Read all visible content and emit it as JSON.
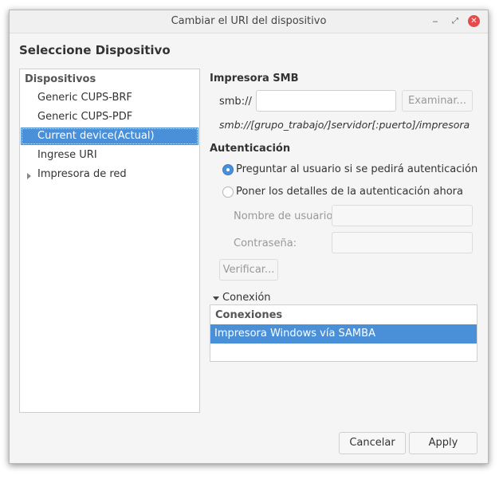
{
  "window": {
    "title": "Cambiar el URI del dispositivo",
    "controls": {
      "minimize": "‒",
      "maximize": "⤢",
      "close": "✕"
    }
  },
  "heading": "Seleccione Dispositivo",
  "devices": {
    "header": "Dispositivos",
    "items": [
      {
        "label": "Generic CUPS-BRF"
      },
      {
        "label": "Generic CUPS-PDF"
      },
      {
        "label": "Current device(Actual)",
        "selected": true
      },
      {
        "label": "Ingrese URI"
      },
      {
        "label": "Impresora de red",
        "expandable": true
      }
    ]
  },
  "smb": {
    "section_title": "Impresora SMB",
    "prefix": "smb://",
    "uri_value": "",
    "browse_label": "Examinar...",
    "hint": "smb://[grupo_trabajo/]servidor[:puerto]/impresora"
  },
  "auth": {
    "section_title": "Autenticación",
    "option_prompt": "Preguntar al usuario si se pedirá autenticación",
    "option_now": "Poner los detalles de la autenticación ahora",
    "selected_option": "prompt",
    "username_label": "Nombre de usuario:",
    "username_value": "",
    "password_label": "Contraseña:",
    "password_value": "",
    "verify_label": "Verificar..."
  },
  "connection": {
    "expander_label": "Conexión",
    "list_header": "Conexiones",
    "items": [
      {
        "label": "Impresora Windows vía SAMBA",
        "selected": true
      }
    ]
  },
  "footer": {
    "cancel_label": "Cancelar",
    "apply_label": "Apply"
  },
  "colors": {
    "selection": "#4a90d9",
    "close_button": "#e54b4b"
  }
}
